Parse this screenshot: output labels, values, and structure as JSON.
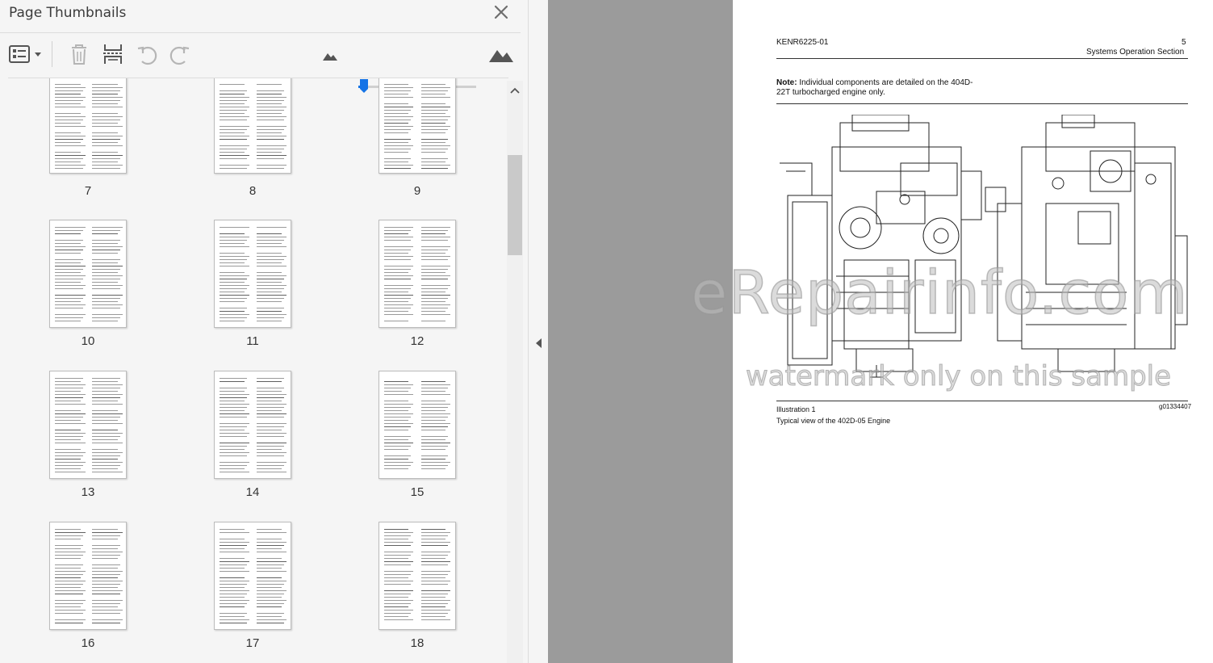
{
  "panel": {
    "title": "Page Thumbnails",
    "toolbar": {
      "options_icon": "thumbnail-options-icon",
      "delete_icon": "trash-icon",
      "extract_icon": "extract-pages-icon",
      "rotate_left_icon": "rotate-counterclockwise-icon",
      "rotate_right_icon": "rotate-clockwise-icon",
      "zoom_out_icon": "small-mountain-icon",
      "zoom_in_icon": "large-mountain-icon",
      "zoom_level": 0.05
    },
    "thumbnails": [
      {
        "page": "7"
      },
      {
        "page": "8"
      },
      {
        "page": "9"
      },
      {
        "page": "10"
      },
      {
        "page": "11"
      },
      {
        "page": "12"
      },
      {
        "page": "13"
      },
      {
        "page": "14"
      },
      {
        "page": "15"
      },
      {
        "page": "16"
      },
      {
        "page": "17"
      },
      {
        "page": "18"
      }
    ]
  },
  "document": {
    "doc_code": "KENR6225-01",
    "page_number": "5",
    "section": "Systems Operation Section",
    "note_label": "Note:",
    "note_text": " Individual components are detailed on the 404D-22T turbocharged engine only.",
    "illustration_label": "Illustration 1",
    "illustration_id": "g01334407",
    "caption": "Typical view of the 402D-05 Engine"
  },
  "watermark": {
    "main": "eRepairinfo.com",
    "sub": "watermark only on this sample"
  },
  "colors": {
    "accent": "#1473e6",
    "panel_bg": "#f5f5f5",
    "gutter": "#9b9b9b"
  }
}
